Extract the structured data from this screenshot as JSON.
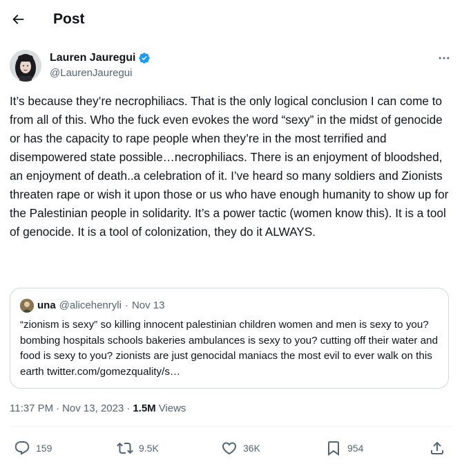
{
  "header": {
    "title": "Post",
    "back_icon": "arrow-left-icon"
  },
  "author": {
    "name": "Lauren Jauregui",
    "handle": "@LaurenJauregui",
    "verified": true,
    "verified_color": "#1d9bf0",
    "more_icon": "more-horizontal-icon"
  },
  "post": {
    "text": "It’s because they’re necrophiliacs. That is the only logical conclusion I can come to from all of this. Who the fuck even evokes the word “sexy” in the midst of genocide or has the capacity to rape people when they’re in the most terrified and disempowered state possible…necrophiliacs. There is an enjoyment of bloodshed, an enjoyment of death..a celebration of it. I’ve heard so many soldiers and Zionists threaten rape or wish it upon those or us who have enough humanity to show up for the Palestinian people in solidarity. It’s a power tactic (women know this). It is a tool of genocide. It is a tool of colonization, they do it ALWAYS."
  },
  "quote": {
    "name": "una",
    "handle": "@alicehenryli",
    "separator": "·",
    "date": "Nov 13",
    "text": "“zionism is sexy” so killing innocent palestinian children women and men is sexy to you? bombing hospitals schools bakeries ambulances is sexy to you? cutting off their water and food is sexy to you? zionists are just genocidal maniacs the most evil to ever walk on this earth twitter.com/gomezquality/s…"
  },
  "meta": {
    "time": "11:37 PM",
    "separator": "·",
    "date": "Nov 13, 2023",
    "views_count": "1.5M",
    "views_label": "Views"
  },
  "actions": {
    "replies": "159",
    "reposts": "9.5K",
    "likes": "36K",
    "bookmarks": "954",
    "icons": [
      "reply-icon",
      "repost-icon",
      "like-icon",
      "bookmark-icon",
      "share-icon"
    ]
  },
  "colors": {
    "text": "#0f1419",
    "secondary": "#536471",
    "border": "#cfd9de",
    "accent": "#1d9bf0"
  }
}
